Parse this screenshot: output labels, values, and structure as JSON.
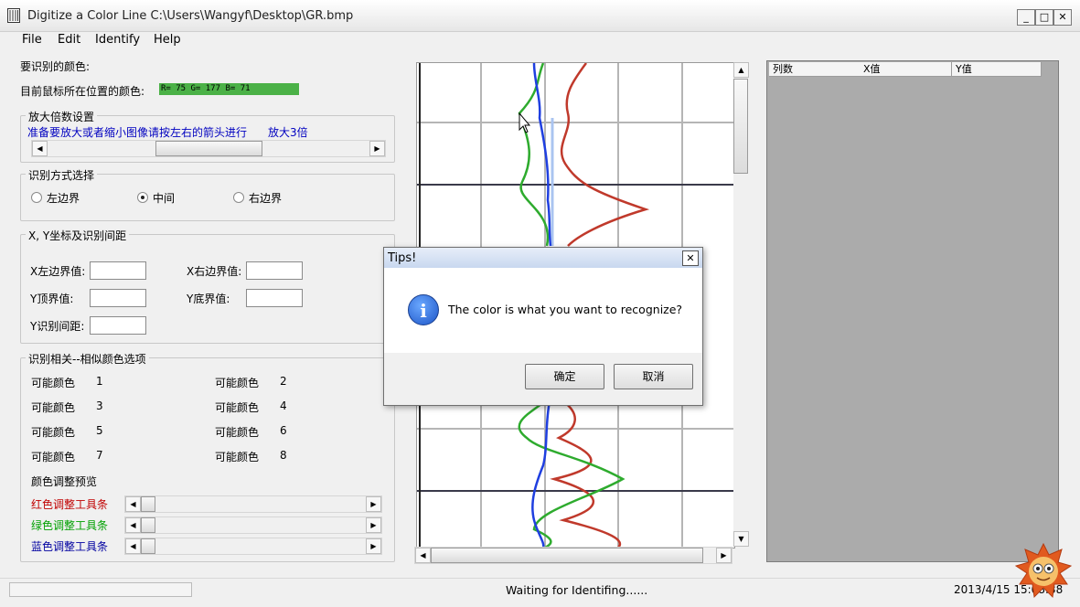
{
  "window": {
    "title": "Digitize a Color Line C:\\Users\\Wangyf\\Desktop\\GR.bmp",
    "minimize": "_",
    "maximize": "□",
    "close": "✕"
  },
  "menu": [
    "File",
    "Edit",
    "Identify",
    "Help"
  ],
  "left_panel": {
    "target_color_label": "要识别的颜色:",
    "cursor_color_label": "目前鼠标所在位置的颜色:",
    "cursor_color_value": "R= 75 G= 177 B= 71",
    "cursor_color_swatch": "#4bb147",
    "zoom_group": {
      "title": "放大倍数设置",
      "hint": "准备要放大或者缩小图像请按左右的箭头进行",
      "zoom_text": "放大3倍"
    },
    "mode_group": {
      "title": "识别方式选择",
      "options": [
        "左边界",
        "中间",
        "右边界"
      ],
      "selected": "中间"
    },
    "xy_group": {
      "title": "X, Y坐标及识别间距",
      "x_left_label": "X左边界值:",
      "x_right_label": "X右边界值:",
      "y_top_label": "Y顶界值:",
      "y_bottom_label": "Y底界值:",
      "y_step_label": "Y识别间距:"
    },
    "similar_group": {
      "title": "识别相关--相似颜色选项",
      "items": [
        {
          "label": "可能颜色",
          "num": "1"
        },
        {
          "label": "可能颜色",
          "num": "2"
        },
        {
          "label": "可能颜色",
          "num": "3"
        },
        {
          "label": "可能颜色",
          "num": "4"
        },
        {
          "label": "可能颜色",
          "num": "5"
        },
        {
          "label": "可能颜色",
          "num": "6"
        },
        {
          "label": "可能颜色",
          "num": "7"
        },
        {
          "label": "可能颜色",
          "num": "8"
        }
      ],
      "preview_label": "颜色调整预览",
      "red_label": "红色调整工具条",
      "green_label": "绿色调整工具条",
      "blue_label": "蓝色调整工具条"
    }
  },
  "colors": {
    "red_text": "#c00000",
    "green_text": "#00a000",
    "blue_text": "#0000a0",
    "hint_text": "#0000c0"
  },
  "table": {
    "columns": [
      "列数",
      "X值",
      "Y值"
    ]
  },
  "dialog": {
    "title": "Tips!",
    "close": "✕",
    "icon": "info-icon",
    "icon_glyph": "i",
    "message": "The color is what you want to recognize?",
    "ok": "确定",
    "cancel": "取消"
  },
  "status": {
    "text": "Waiting for Identifing......",
    "datetime": "2013/4/15 15:08:38"
  }
}
